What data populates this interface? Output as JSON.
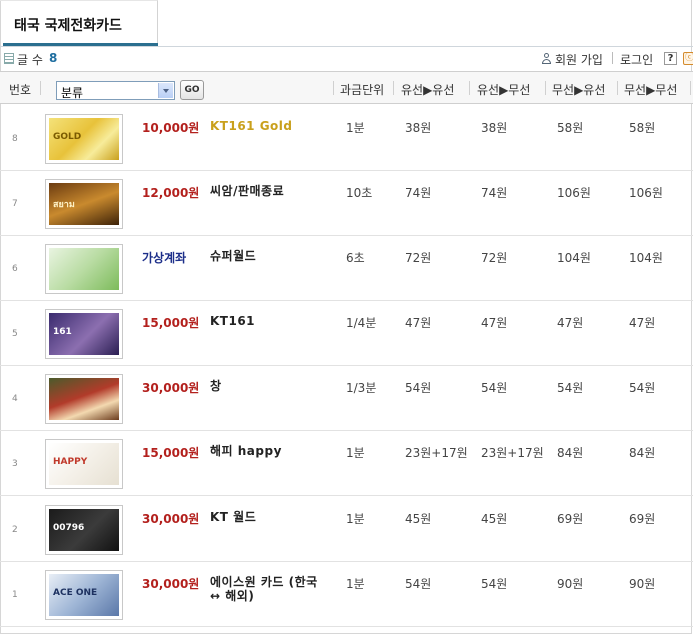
{
  "page": {
    "title": "태국 국제전화카드"
  },
  "count": {
    "label": "글 수",
    "value": "8"
  },
  "nav": {
    "join": "회원 가입",
    "login": "로그인",
    "help": "?",
    "extra": "ⓒ"
  },
  "header": {
    "no": "번호",
    "category": "분류",
    "go": "GO",
    "unit": "과금단위",
    "c1": "유선▶유선",
    "c2": "유선▶무선",
    "c3": "무선▶유선",
    "c4": "무선▶무선"
  },
  "colors": {
    "price_red": "#b3201d",
    "price_blue": "#1d2f8a",
    "name_gold": "#c9a01c",
    "accent": "#2b6f8f"
  },
  "rows": [
    {
      "no": "8",
      "price": "10,000원",
      "name": "KT161 Gold",
      "unit": "1분",
      "c1": "38원",
      "c2": "38원",
      "c3": "58원",
      "c4": "58원"
    },
    {
      "no": "7",
      "price": "12,000원",
      "name": "씨암/판매종료",
      "unit": "10초",
      "c1": "74원",
      "c2": "74원",
      "c3": "106원",
      "c4": "106원"
    },
    {
      "no": "6",
      "price": "가상계좌",
      "name": "슈퍼월드",
      "unit": "6초",
      "c1": "72원",
      "c2": "72원",
      "c3": "104원",
      "c4": "104원"
    },
    {
      "no": "5",
      "price": "15,000원",
      "name": "KT161",
      "unit": "1/4분",
      "c1": "47원",
      "c2": "47원",
      "c3": "47원",
      "c4": "47원"
    },
    {
      "no": "4",
      "price": "30,000원",
      "name": "창",
      "unit": "1/3분",
      "c1": "54원",
      "c2": "54원",
      "c3": "54원",
      "c4": "54원"
    },
    {
      "no": "3",
      "price": "15,000원",
      "name": "해피 happy",
      "unit": "1분",
      "c1": "23원+17원",
      "c2": "23원+17원",
      "c3": "84원",
      "c4": "84원"
    },
    {
      "no": "2",
      "price": "30,000원",
      "name": "KT 월드",
      "unit": "1분",
      "c1": "45원",
      "c2": "45원",
      "c3": "69원",
      "c4": "69원"
    },
    {
      "no": "1",
      "price": "30,000원",
      "name": "에이스원 카드 (한국 ↔ 해외)",
      "unit": "1분",
      "c1": "54원",
      "c2": "54원",
      "c3": "90원",
      "c4": "90원"
    }
  ],
  "cards": [
    {
      "label": "GOLD"
    },
    {
      "label": "สยาม"
    },
    {
      "label": ""
    },
    {
      "label": "161"
    },
    {
      "label": ""
    },
    {
      "label": "HAPPY"
    },
    {
      "label": "00796"
    },
    {
      "label": "ACE ONE"
    }
  ]
}
